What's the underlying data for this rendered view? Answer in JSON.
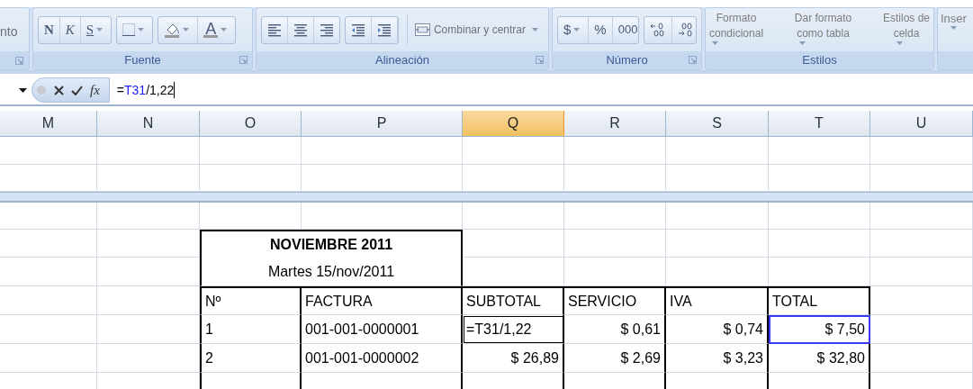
{
  "ribbon": {
    "cut_group": {
      "label": "nto"
    },
    "font_group": {
      "label": "Fuente",
      "bold_button": "N",
      "italic_button": "K",
      "underline_button": "S",
      "font_color_button": "A"
    },
    "alignment_group": {
      "label": "Alineación",
      "merge_button": "Combinar y centrar"
    },
    "number_group": {
      "label": "Número",
      "currency_button": "$",
      "percent_button": "%",
      "thousands_button": "000"
    },
    "styles_group": {
      "label": "Estilos",
      "buttons": [
        {
          "lines": [
            "Formato",
            "condicional"
          ]
        },
        {
          "lines": [
            "Dar formato",
            "como tabla"
          ]
        },
        {
          "lines": [
            "Estilos de",
            "celda"
          ]
        }
      ]
    },
    "insert_group": {
      "label": "Inser"
    }
  },
  "formula_bar": {
    "fx_label": "fx",
    "formula": [
      {
        "text": "=",
        "ref": false
      },
      {
        "text": "T31",
        "ref": true
      },
      {
        "text": "/1,22",
        "ref": false
      }
    ]
  },
  "columns": [
    {
      "label": "M",
      "selected": false
    },
    {
      "label": "N",
      "selected": false
    },
    {
      "label": "O",
      "selected": false
    },
    {
      "label": "P",
      "selected": false
    },
    {
      "label": "Q",
      "selected": true
    },
    {
      "label": "R",
      "selected": false
    },
    {
      "label": "S",
      "selected": false
    },
    {
      "label": "T",
      "selected": false
    },
    {
      "label": "U",
      "selected": false
    }
  ],
  "table": {
    "title": "NOVIEMBRE 2011",
    "subtitle": "Martes 15/nov/2011",
    "headers": [
      "Nº",
      "FACTURA",
      "SUBTOTAL",
      "SERVICIO",
      "IVA",
      "TOTAL"
    ],
    "rows": [
      {
        "cells": [
          {
            "text": "1"
          },
          {
            "text": "001-001-0000001"
          },
          {
            "text": "=T31/1,22",
            "editing": true,
            "referenced": false
          },
          {
            "text": "$ 0,61"
          },
          {
            "text": "$ 0,74"
          },
          {
            "text": "$ 7,50",
            "editing": false,
            "referenced": true
          }
        ]
      },
      {
        "cells": [
          {
            "text": "2"
          },
          {
            "text": "001-001-0000002"
          },
          {
            "text": "$ 26,89"
          },
          {
            "text": "$ 2,69"
          },
          {
            "text": "$ 3,23"
          },
          {
            "text": "$ 32,80"
          }
        ]
      }
    ]
  }
}
